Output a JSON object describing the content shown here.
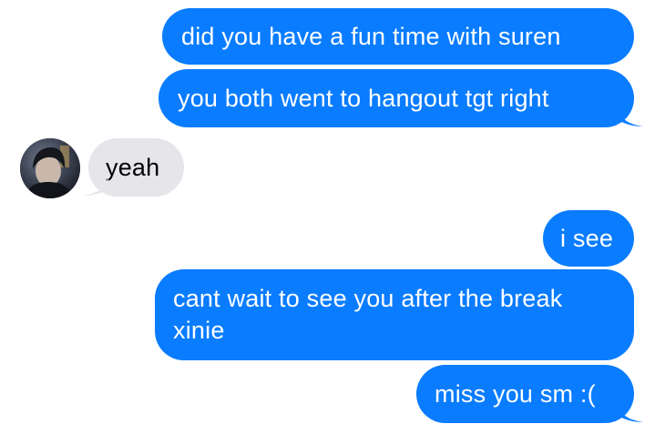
{
  "conversation": {
    "messages": [
      {
        "from": "me",
        "text": "did you have a fun time with suren"
      },
      {
        "from": "me",
        "text": "you both went to hangout tgt right"
      },
      {
        "from": "contact",
        "text": "yeah"
      },
      {
        "from": "me",
        "text": "i see"
      },
      {
        "from": "me",
        "text": "cant wait to see you after the break xinie"
      },
      {
        "from": "me",
        "text": "miss you sm :("
      }
    ]
  },
  "colors": {
    "sent_bubble": "#0a7cff",
    "received_bubble": "#e5e5ea",
    "background": "#ffffff"
  }
}
